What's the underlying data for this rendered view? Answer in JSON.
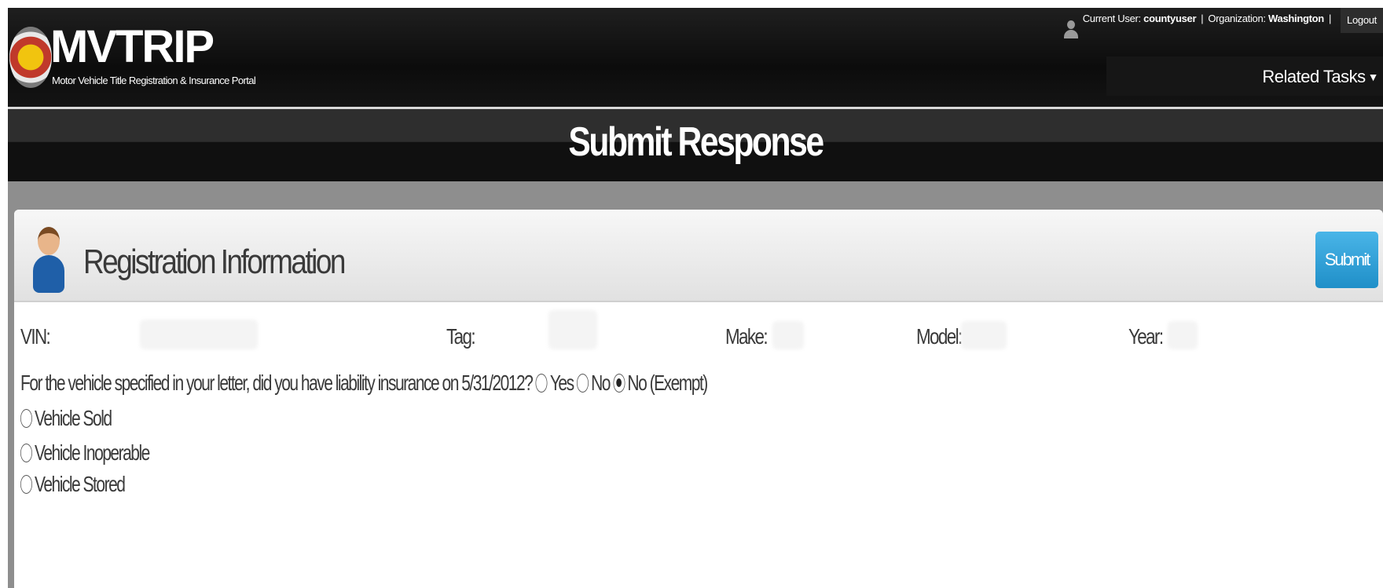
{
  "header": {
    "logo_title": "MVTRIP",
    "logo_subtitle": "Motor Vehicle Title Registration & Insurance Portal",
    "current_user_label": "Current User:",
    "current_user": "countyuser",
    "organization_label": "Organization:",
    "organization": "Washington",
    "separator": "|",
    "logout_label": "Logout",
    "related_tasks_label": "Related Tasks"
  },
  "page": {
    "title": "Submit Response"
  },
  "panel": {
    "title": "Registration Information",
    "submit_label": "Submit",
    "fields": {
      "vin_label": "VIN:",
      "tag_label": "Tag:",
      "make_label": "Make:",
      "model_label": "Model:",
      "year_label": "Year:"
    },
    "question": {
      "text": "For the vehicle specified in your letter, did you have liability insurance on 5/31/2012?",
      "options": [
        "Yes",
        "No",
        "No (Exempt)"
      ],
      "selected": "No (Exempt)"
    },
    "exempt_options": [
      "Vehicle Sold",
      "Vehicle Inoperable",
      "Vehicle Stored"
    ]
  }
}
